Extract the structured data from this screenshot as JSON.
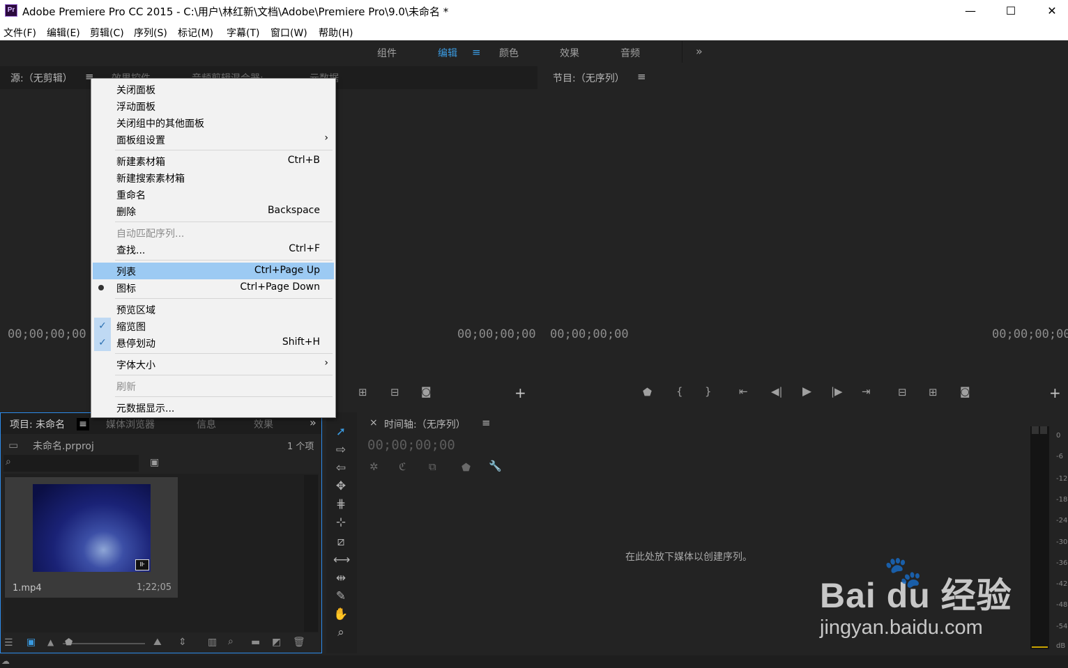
{
  "title": {
    "app_icon": "Pr",
    "text": "Adobe Premiere Pro CC 2015 - C:\\用户\\林红新\\文档\\Adobe\\Premiere Pro\\9.0\\未命名 *",
    "minimize": "—",
    "maximize": "☐",
    "close": "✕"
  },
  "menubar": [
    "文件(F)",
    "编辑(E)",
    "剪辑(C)",
    "序列(S)",
    "标记(M)",
    "字幕(T)",
    "窗口(W)",
    "帮助(H)"
  ],
  "workspaces": {
    "items": [
      "组件",
      "编辑",
      "颜色",
      "效果",
      "音频"
    ],
    "active": "编辑",
    "more": "»"
  },
  "source": {
    "tab_source": "源:（无剪辑）",
    "tab_effect_controls": "效果控件",
    "tab_audio_mixer": "音频剪辑混合器:",
    "tab_metadata": "元数据",
    "tc_left": "00;00;00;00",
    "tc_right": "00;00;00;00"
  },
  "program": {
    "tab": "节目:（无序列）",
    "tc_left": "00;00;00;00",
    "tc_right": "00;00;00;00"
  },
  "context_menu": [
    {
      "label": "关闭面板",
      "shortcut": "",
      "state": ""
    },
    {
      "label": "浮动面板",
      "shortcut": "",
      "state": ""
    },
    {
      "label": "关闭组中的其他面板",
      "shortcut": "",
      "state": ""
    },
    {
      "label": "面板组设置",
      "shortcut": "",
      "state": "",
      "submenu": true
    },
    {
      "sep": true
    },
    {
      "label": "新建素材箱",
      "shortcut": "Ctrl+B",
      "state": ""
    },
    {
      "label": "新建搜索素材箱",
      "shortcut": "",
      "state": ""
    },
    {
      "label": "重命名",
      "shortcut": "",
      "state": ""
    },
    {
      "label": "删除",
      "shortcut": "Backspace",
      "state": ""
    },
    {
      "sep": true
    },
    {
      "label": "自动匹配序列...",
      "shortcut": "",
      "state": "disabled"
    },
    {
      "label": "查找...",
      "shortcut": "Ctrl+F",
      "state": ""
    },
    {
      "sep": true
    },
    {
      "label": "列表",
      "shortcut": "Ctrl+Page Up",
      "state": "highlighted"
    },
    {
      "label": "图标",
      "shortcut": "Ctrl+Page Down",
      "state": "radio"
    },
    {
      "sep": true
    },
    {
      "label": "预览区域",
      "shortcut": "",
      "state": ""
    },
    {
      "label": "缩览图",
      "shortcut": "",
      "state": "checked"
    },
    {
      "label": "悬停划动",
      "shortcut": "Shift+H",
      "state": "checked"
    },
    {
      "sep": true
    },
    {
      "label": "字体大小",
      "shortcut": "",
      "state": "",
      "submenu": true
    },
    {
      "sep": true
    },
    {
      "label": "刷新",
      "shortcut": "",
      "state": "disabled"
    },
    {
      "sep": true
    },
    {
      "label": "元数据显示...",
      "shortcut": "",
      "state": ""
    }
  ],
  "project": {
    "tab": "项目: 未命名",
    "tab_media_browser": "媒体浏览器",
    "tab_info": "信息",
    "tab_effects": "效果",
    "more": "»",
    "file_name": "未命名.prproj",
    "item_count": "1 个项",
    "clip_name": "1.mp4",
    "clip_duration": "1;22;05"
  },
  "timeline": {
    "close": "×",
    "tab": "时间轴:（无序列）",
    "timecode": "00;00;00;00",
    "drop_hint": "在此处放下媒体以创建序列。"
  },
  "meter": {
    "labels": [
      "0",
      "-6",
      "-12",
      "-18",
      "-24",
      "-30",
      "-36",
      "-42",
      "-48",
      "-54",
      "dB"
    ]
  },
  "watermark": {
    "brand": "Bai du 经验",
    "url": "jingyan.baidu.com"
  },
  "colors": {
    "accent": "#3a9ae0",
    "menu_highlight": "#9ccaf3",
    "panel_bg": "#232323"
  }
}
